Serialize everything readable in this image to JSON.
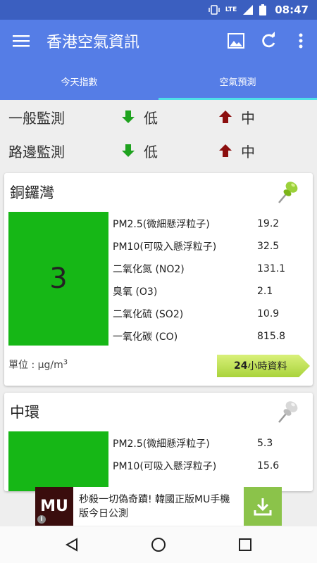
{
  "status_bar": {
    "network": "LTE",
    "time": "08:47"
  },
  "app": {
    "title": "香港空氣資訊"
  },
  "tabs": [
    {
      "label": "今天指數",
      "active": false
    },
    {
      "label": "空氣預測",
      "active": true
    }
  ],
  "summary": [
    {
      "label": "一般監測",
      "low_text": "低",
      "high_text": "中"
    },
    {
      "label": "路邊監測",
      "low_text": "低",
      "high_text": "中"
    }
  ],
  "colors": {
    "down_arrow": "#1ea21e",
    "up_arrow": "#8b0e0e",
    "aqhi_green": "#16b716",
    "app_bar": "#557de6",
    "tab_indicator": "#4ee0e8"
  },
  "stations": [
    {
      "name": "銅鑼灣",
      "aqhi": "3",
      "pinned": true,
      "pollutants": [
        {
          "name": "PM2.5(微細懸浮粒子)",
          "value": "19.2"
        },
        {
          "name": "PM10(可吸入懸浮粒子)",
          "value": "32.5"
        },
        {
          "name": "二氧化氮 (NO2)",
          "value": "131.1"
        },
        {
          "name": "臭氧 (O3)",
          "value": "2.1"
        },
        {
          "name": "二氧化硫 (SO2)",
          "value": "10.9"
        },
        {
          "name": "一氧化碳 (CO)",
          "value": "815.8"
        }
      ],
      "unit_label": "單位 : μg/m",
      "unit_sup": "3",
      "history_button_bold": "24",
      "history_button_rest": "小時資料"
    },
    {
      "name": "中環",
      "pinned": false,
      "pollutants": [
        {
          "name": "PM2.5(微細懸浮粒子)",
          "value": "5.3"
        },
        {
          "name": "PM10(可吸入懸浮粒子)",
          "value": "15.6"
        }
      ]
    }
  ],
  "ad": {
    "logo_text": "MU",
    "text": "秒殺一切偽奇蹟! 韓國正版MU手機版今日公測"
  }
}
